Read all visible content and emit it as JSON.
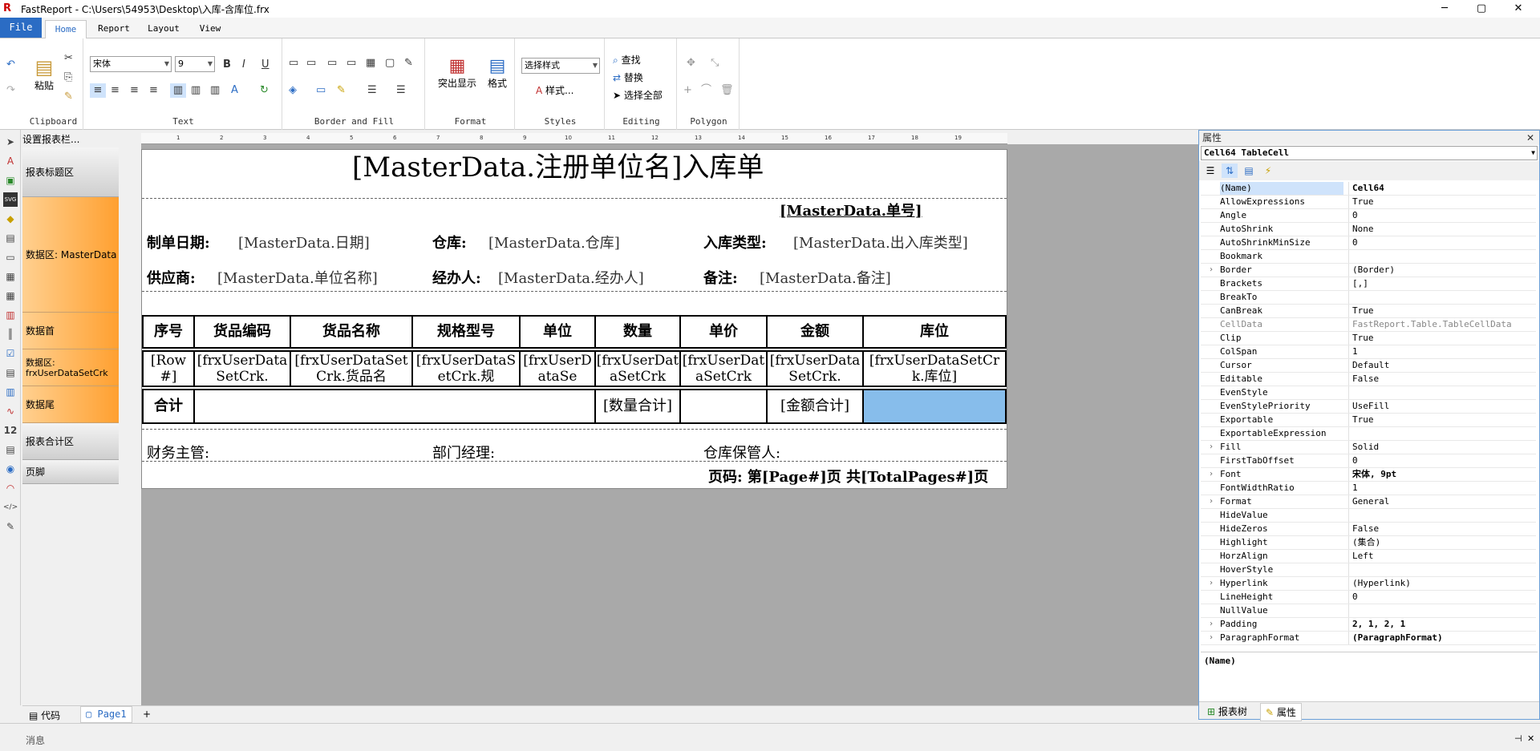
{
  "window": {
    "title": "FastReport - C:\\Users\\54953\\Desktop\\入库-含库位.frx",
    "minimize": "─",
    "maximize": "▢",
    "close": "✕"
  },
  "tabs": [
    {
      "label": "File"
    },
    {
      "label": "Home"
    },
    {
      "label": "Report"
    },
    {
      "label": "Layout"
    },
    {
      "label": "View"
    }
  ],
  "ribbon": {
    "clipboard": {
      "label": "Clipboard",
      "paste": "粘贴"
    },
    "text": {
      "label": "Text",
      "font": "宋体",
      "size": "9"
    },
    "border": {
      "label": "Border and Fill"
    },
    "format": {
      "label": "Format",
      "highlight": "突出显示",
      "format_btn": "格式"
    },
    "styles": {
      "label": "Styles",
      "combo": "选择样式",
      "styles_btn": "样式..."
    },
    "editing": {
      "label": "Editing",
      "find": "查找",
      "replace": "替换",
      "select_all": "选择全部"
    },
    "polygon": {
      "label": "Polygon"
    }
  },
  "bands": {
    "header": "设置报表栏...",
    "items": [
      "报表标题区",
      "数据区: MasterData",
      "数据首",
      "数据区: frxUserDataSetCrk",
      "数据尾",
      "报表合计区",
      "页脚"
    ]
  },
  "report": {
    "title": "[MasterData.注册单位名]入库单",
    "order_no": "[MasterData.单号]",
    "date_label": "制单日期:",
    "date_val": "[MasterData.日期]",
    "wh_label": "仓库:",
    "wh_val": "[MasterData.仓库]",
    "type_label": "入库类型:",
    "type_val": "[MasterData.出入库类型]",
    "sup_label": "供应商:",
    "sup_val": "[MasterData.单位名称]",
    "agent_label": "经办人:",
    "agent_val": "[MasterData.经办人]",
    "note_label": "备注:",
    "note_val": "[MasterData.备注]",
    "headers": [
      "序号",
      "货品编码",
      "货品名称",
      "规格型号",
      "单位",
      "数量",
      "单价",
      "金额",
      "库位"
    ],
    "row": [
      "[Row#]",
      "[frxUserDataSetCrk.",
      "[frxUserDataSetCrk.货品名",
      "[frxUserDataSetCrk.规",
      "[frxUserDataSe",
      "[frxUserDataSetCrk",
      "[frxUserDataSetCrk",
      "[frxUserDataSetCrk.",
      "[frxUserDataSetCrk.库位]"
    ],
    "total_label": "合计",
    "qty_total": "[数量合计]",
    "amt_total": "[金额合计]",
    "finance": "财务主管:",
    "dept": "部门经理:",
    "keeper": "仓库保管人:",
    "page": "页码: 第[Page#]页 共[TotalPages#]页"
  },
  "ruler": [
    "1",
    "2",
    "3",
    "4",
    "5",
    "6",
    "7",
    "8",
    "9",
    "10",
    "11",
    "12",
    "13",
    "14",
    "15",
    "16",
    "17",
    "18",
    "19"
  ],
  "props": {
    "header": "属性",
    "object": "Cell64 TableCell",
    "description": "(Name)",
    "bottom_tabs": [
      "报表树",
      "属性"
    ],
    "rows": [
      {
        "n": "(Name)",
        "v": "Cell64",
        "bold": true
      },
      {
        "n": "AllowExpressions",
        "v": "True"
      },
      {
        "n": "Angle",
        "v": "0"
      },
      {
        "n": "AutoShrink",
        "v": "None"
      },
      {
        "n": "AutoShrinkMinSize",
        "v": "0"
      },
      {
        "n": "Bookmark",
        "v": ""
      },
      {
        "n": "Border",
        "v": "(Border)",
        "ex": true
      },
      {
        "n": "Brackets",
        "v": "[,]"
      },
      {
        "n": "BreakTo",
        "v": ""
      },
      {
        "n": "CanBreak",
        "v": "True"
      },
      {
        "n": "CellData",
        "v": "FastReport.Table.TableCellData",
        "grey": true
      },
      {
        "n": "Clip",
        "v": "True"
      },
      {
        "n": "ColSpan",
        "v": "1"
      },
      {
        "n": "Cursor",
        "v": "Default"
      },
      {
        "n": "Editable",
        "v": "False"
      },
      {
        "n": "EvenStyle",
        "v": ""
      },
      {
        "n": "EvenStylePriority",
        "v": "UseFill"
      },
      {
        "n": "Exportable",
        "v": "True"
      },
      {
        "n": "ExportableExpression",
        "v": ""
      },
      {
        "n": "Fill",
        "v": "Solid",
        "ex": true
      },
      {
        "n": "FirstTabOffset",
        "v": "0"
      },
      {
        "n": "Font",
        "v": "宋体, 9pt",
        "ex": true,
        "bold": true
      },
      {
        "n": "FontWidthRatio",
        "v": "1"
      },
      {
        "n": "Format",
        "v": "General",
        "ex": true
      },
      {
        "n": "HideValue",
        "v": ""
      },
      {
        "n": "HideZeros",
        "v": "False"
      },
      {
        "n": "Highlight",
        "v": "(集合)"
      },
      {
        "n": "HorzAlign",
        "v": "Left"
      },
      {
        "n": "HoverStyle",
        "v": ""
      },
      {
        "n": "Hyperlink",
        "v": "(Hyperlink)",
        "ex": true
      },
      {
        "n": "LineHeight",
        "v": "0"
      },
      {
        "n": "NullValue",
        "v": ""
      },
      {
        "n": "Padding",
        "v": "2, 1, 2, 1",
        "ex": true,
        "bold": true
      },
      {
        "n": "ParagraphFormat",
        "v": "(ParagraphFormat)",
        "ex": true,
        "bold": true
      }
    ]
  },
  "bottom_tabs": [
    "代码",
    "Page1",
    "+"
  ],
  "status": {
    "messages": "消息",
    "pin": "⊣",
    "close": "✕"
  }
}
